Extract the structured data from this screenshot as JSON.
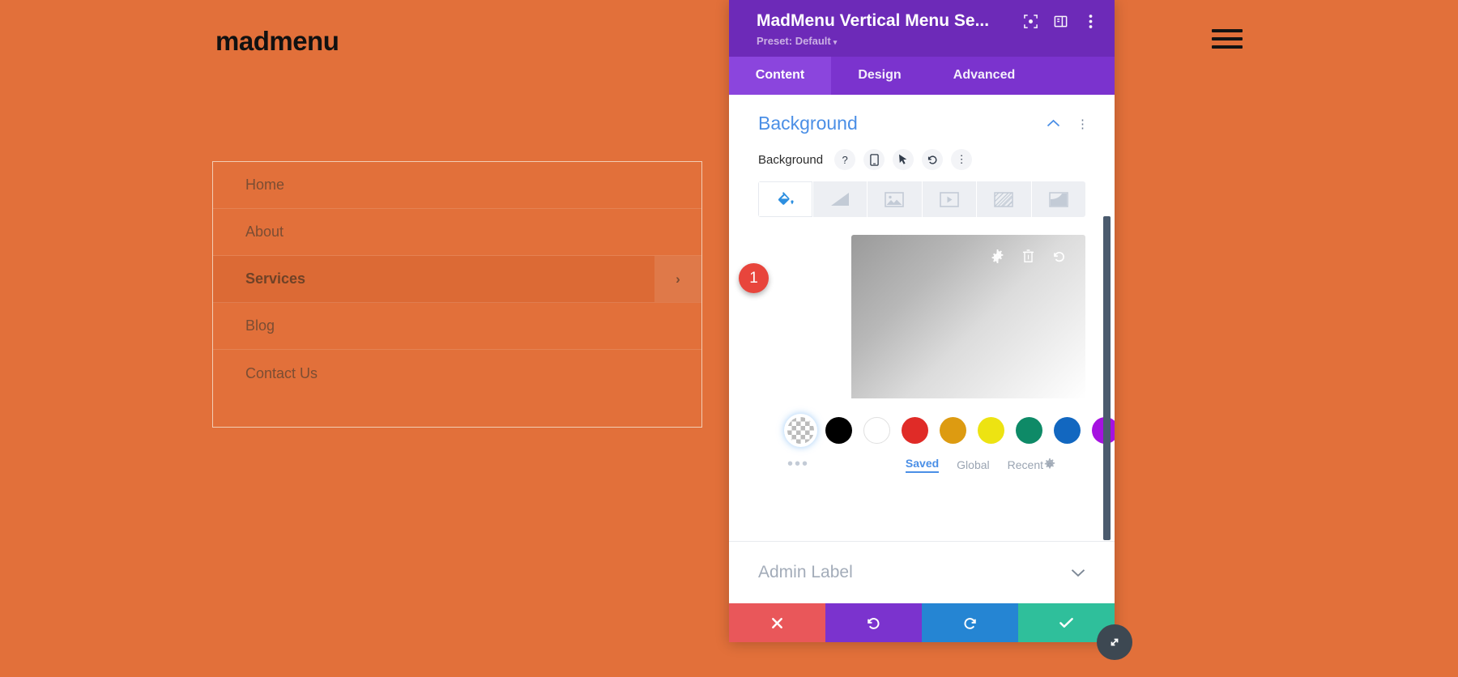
{
  "site": {
    "logo": "madmenu",
    "background_color": "#e2703a",
    "menu_items": [
      {
        "label": "Home",
        "active": false,
        "has_submenu": false
      },
      {
        "label": "About",
        "active": false,
        "has_submenu": false
      },
      {
        "label": "Services",
        "active": true,
        "has_submenu": true
      },
      {
        "label": "Blog",
        "active": false,
        "has_submenu": false
      },
      {
        "label": "Contact Us",
        "active": false,
        "has_submenu": false
      }
    ],
    "submenu_arrow": "›"
  },
  "modal": {
    "title": "MadMenu Vertical Menu Se...",
    "preset_label": "Preset: Default",
    "preset_caret": "▾",
    "header_color": "#6d2ab8",
    "tabs": [
      {
        "label": "Content",
        "active": true
      },
      {
        "label": "Design",
        "active": false
      },
      {
        "label": "Advanced",
        "active": false
      }
    ],
    "section": {
      "title": "Background",
      "collapse_caret": "⌃",
      "kebab": "⋮"
    },
    "field": {
      "label": "Background",
      "help": "?",
      "responsive": "mobile-icon",
      "hover": "cursor-icon",
      "reset": "↺",
      "options": "⋮"
    },
    "bg_type_tabs": [
      {
        "name": "color",
        "active": true
      },
      {
        "name": "gradient",
        "active": false
      },
      {
        "name": "image",
        "active": false
      },
      {
        "name": "video",
        "active": false
      },
      {
        "name": "pattern",
        "active": false
      },
      {
        "name": "mask",
        "active": false
      }
    ],
    "marker_badge": "1",
    "gradient_preview_icons": {
      "settings": "⚙",
      "delete": "🗑",
      "reset": "↺"
    },
    "swatches": [
      {
        "name": "transparent",
        "color": "transparent",
        "selected": true
      },
      {
        "name": "black",
        "color": "#000000",
        "selected": false
      },
      {
        "name": "white",
        "color": "#ffffff",
        "selected": false
      },
      {
        "name": "red",
        "color": "#e02b27",
        "selected": false
      },
      {
        "name": "amber",
        "color": "#dd9b11",
        "selected": false
      },
      {
        "name": "yellow",
        "color": "#ede312",
        "selected": false
      },
      {
        "name": "teal",
        "color": "#0e8a67",
        "selected": false
      },
      {
        "name": "blue",
        "color": "#1267c0",
        "selected": false
      },
      {
        "name": "purple",
        "color": "#a512e0",
        "selected": false
      },
      {
        "name": "none",
        "color": "none",
        "selected": false
      }
    ],
    "more_dots": "•••",
    "source_tabs": [
      {
        "label": "Saved",
        "active": true
      },
      {
        "label": "Global",
        "active": false
      },
      {
        "label": "Recent",
        "active": false
      }
    ],
    "source_gear": "⚙",
    "admin_label": {
      "title": "Admin Label",
      "chevron": "⌄"
    },
    "actions": [
      {
        "name": "cancel",
        "icon": "✖",
        "color": "#e9575a"
      },
      {
        "name": "undo",
        "icon": "↺",
        "color": "#7b33ce"
      },
      {
        "name": "redo",
        "icon": "↻",
        "color": "#2585d3"
      },
      {
        "name": "save",
        "icon": "✔",
        "color": "#2fbf9b"
      }
    ],
    "resize_icon": "⤡"
  }
}
